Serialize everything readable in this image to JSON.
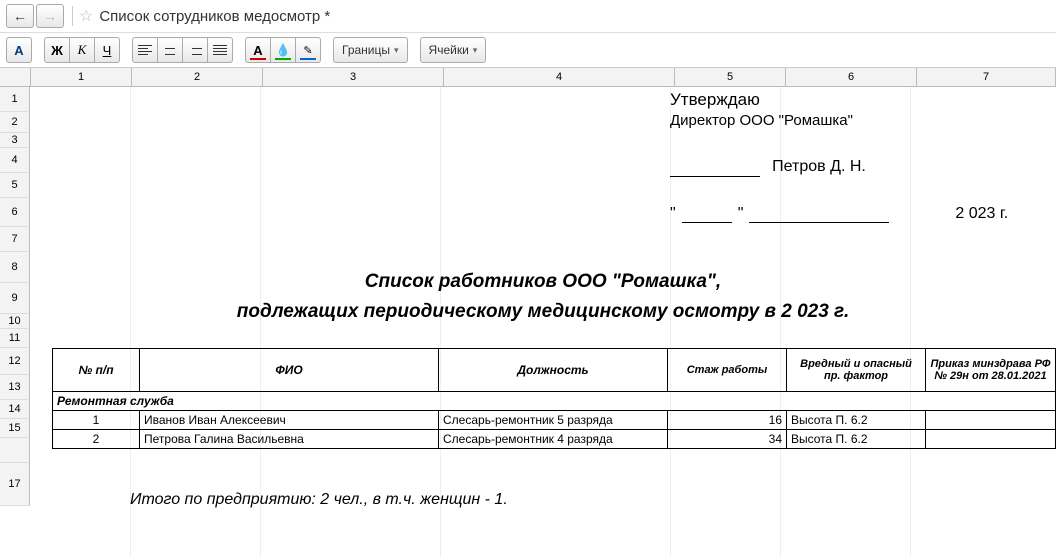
{
  "doc_title": "Список сотрудников медосмотр *",
  "toolbar": {
    "font_color_letter": "А",
    "bold": "Ж",
    "italic": "К",
    "underline": "Ч",
    "color_letter": "А",
    "borders": "Границы",
    "cells": "Ячейки"
  },
  "col_headers": [
    "1",
    "2",
    "3",
    "4",
    "5",
    "6",
    "7"
  ],
  "row_headers": [
    "1",
    "2",
    "3",
    "4",
    "5",
    "6",
    "7",
    "8",
    "9",
    "10",
    "11",
    "12",
    "13",
    "14",
    "15",
    "",
    "17"
  ],
  "approval": {
    "line1": "Утверждаю",
    "line2": "Директор ООО \"Ромашка\"",
    "name": "Петров Д. Н.",
    "year": "2 023 г."
  },
  "title": {
    "line1": "Список работников ООО \"Ромашка\",",
    "line2": "подлежащих периодическому медицинскому осмотру в 2 023 г."
  },
  "table": {
    "headers": {
      "num": "№ п/п",
      "fio": "ФИО",
      "position": "Должность",
      "experience": "Стаж работы",
      "factor": "Вредный и опасный пр. фактор",
      "order": "Приказ минздрава РФ № 29н от 28.01.2021"
    },
    "section": "Ремонтная служба",
    "rows": [
      {
        "num": "1",
        "fio": "Иванов Иван Алексеевич",
        "position": "Слесарь-ремонтник 5 разряда",
        "exp": "16",
        "factor": "Высота П. 6.2",
        "order": ""
      },
      {
        "num": "2",
        "fio": "Петрова Галина Васильевна",
        "position": "Слесарь-ремонтник 4 разряда",
        "exp": "34",
        "factor": "Высота П. 6.2",
        "order": ""
      }
    ]
  },
  "total": "Итого по предприятию: 2 чел., в т.ч. женщин -  1."
}
